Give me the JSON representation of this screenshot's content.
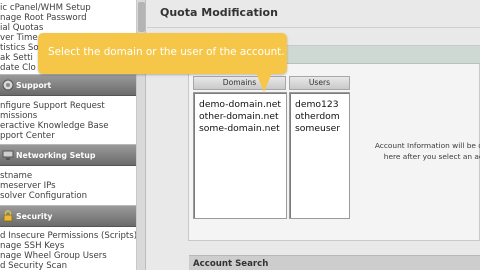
{
  "sidebar": {
    "links": [
      "ic cPanel/WHM Setup",
      "nage Root Password",
      "ial Quotas",
      "ver Time",
      "tistics Sof",
      "ak Setti",
      "date Clo"
    ],
    "sections": [
      {
        "title": "Support",
        "items": [
          "nfigure Support Request",
          "missions",
          "eractive Knowledge Base",
          "pport Center"
        ]
      },
      {
        "title": "Networking Setup",
        "items": [
          "stname",
          "meserver IPs",
          "solver Configuration"
        ]
      },
      {
        "title": "Security",
        "items": [
          "d Insecure Permissions (Scripts)",
          "nage SSH Keys",
          "nage Wheel Group Users",
          "d Security Scan"
        ]
      }
    ]
  },
  "main": {
    "title": "Quota Modification",
    "tooltip": "Select the domain or the user of the account.",
    "columns": {
      "domains_header": "Domains",
      "users_header": "Users"
    },
    "domains": [
      "demo-domain.net",
      "other-domain.net",
      "some-domain.net"
    ],
    "users": [
      "demo123",
      "otherdom",
      "someuser"
    ],
    "info_line1": "Account Information will be d",
    "info_line2": "here after you select an ac",
    "account_search": "Account Search"
  },
  "colors": {
    "tooltip_bg": "#f6c648",
    "sidebar_header": "#7a7a7a",
    "page_bg": "#e9e9e9"
  }
}
